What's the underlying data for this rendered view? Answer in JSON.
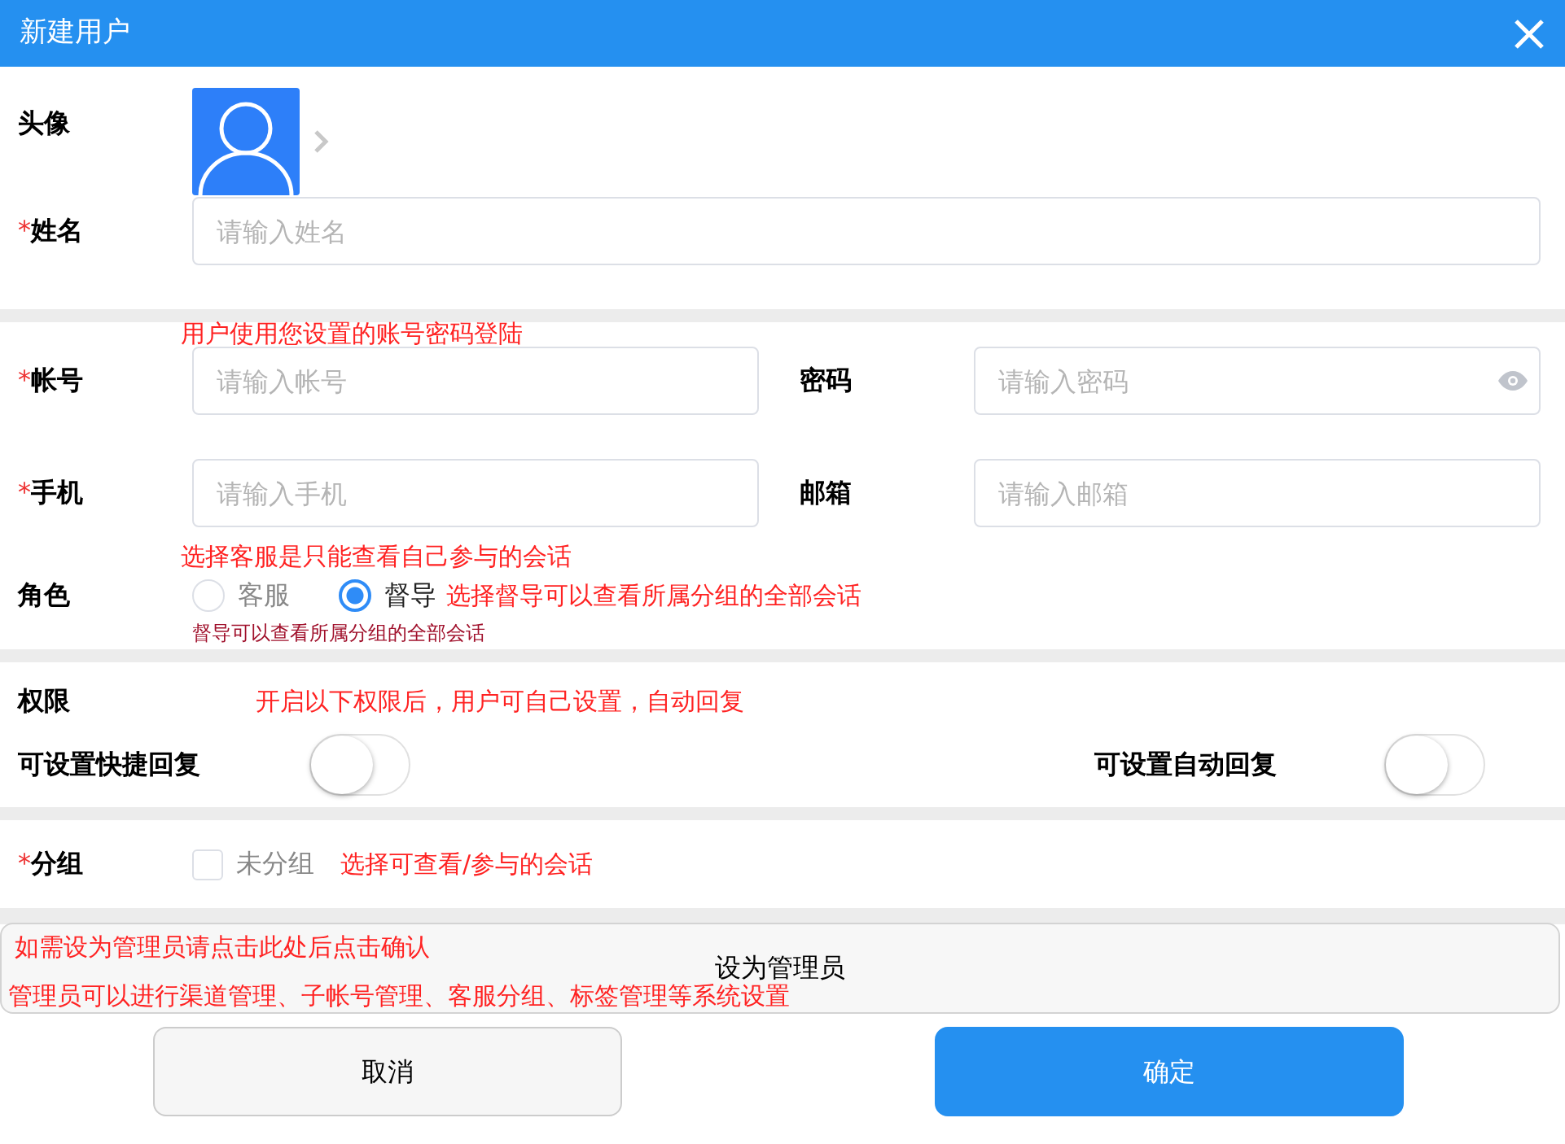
{
  "header": {
    "title": "新建用户"
  },
  "avatar": {
    "label": "头像"
  },
  "name": {
    "label": "姓名",
    "required_mark": "*",
    "placeholder": "请输入姓名"
  },
  "account_note": "用户使用您设置的账号密码登陆",
  "account_rows": [
    [
      {
        "label": "帐号",
        "required_mark": "*",
        "placeholder": "请输入帐号",
        "kind": "text"
      },
      {
        "label": "密码",
        "placeholder": "请输入密码",
        "kind": "password"
      }
    ],
    [
      {
        "label": "手机",
        "required_mark": "*",
        "placeholder": "请输入手机",
        "kind": "text"
      },
      {
        "label": "邮箱",
        "placeholder": "请输入邮箱",
        "kind": "text"
      }
    ]
  ],
  "role": {
    "label": "角色",
    "note": "选择客服是只能查看自己参与的会话",
    "options": [
      {
        "label": "客服",
        "selected": false
      },
      {
        "label": "督导",
        "selected": true
      }
    ],
    "option_note": "选择督导可以查看所属分组的全部会话",
    "hint": "督导可以查看所属分组的全部会话"
  },
  "permissions": {
    "label": "权限",
    "note": "开启以下权限后，用户可自己设置，自动回复",
    "toggles": [
      {
        "label": "可设置快捷回复",
        "on": false
      },
      {
        "label": "可设置自动回复",
        "on": false
      }
    ]
  },
  "group": {
    "label": "分组",
    "required_mark": "*",
    "options": [
      {
        "label": "未分组",
        "checked": false
      }
    ],
    "note": "选择可查看/参与的会话"
  },
  "admin": {
    "note": "如需设为管理员请点击此处后点击确认",
    "button": "设为管理员",
    "description": "管理员可以进行渠道管理、子帐号管理、客服分组、标签管理等系统设置"
  },
  "buttons": [
    {
      "label": "取消",
      "kind": "secondary"
    },
    {
      "label": "确定",
      "kind": "primary"
    }
  ]
}
